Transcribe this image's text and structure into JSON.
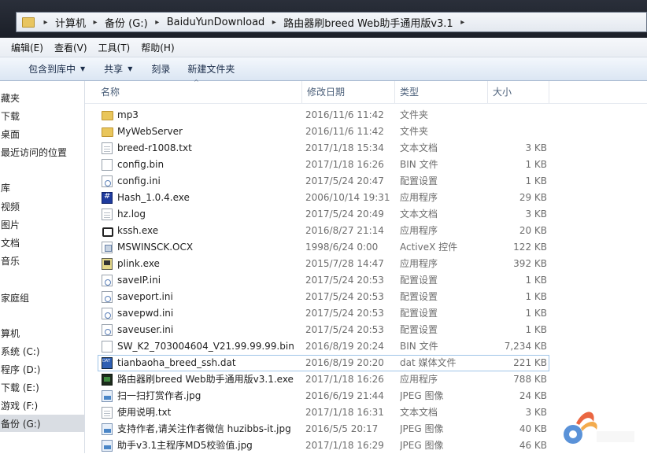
{
  "address": {
    "crumbs": [
      "计算机",
      "备份 (G:)",
      "BaiduYunDownload",
      "路由器刷breed Web助手通用版v3.1"
    ]
  },
  "menu": [
    "编辑(E)",
    "查看(V)",
    "工具(T)",
    "帮助(H)"
  ],
  "toolbar": {
    "include_library": "包含到库中",
    "share": "共享",
    "burn": "刻录",
    "new_folder": "新建文件夹"
  },
  "nav": {
    "items": [
      {
        "label": "藏夹",
        "selected": false
      },
      {
        "label": "下载",
        "selected": false
      },
      {
        "label": "桌面",
        "selected": false
      },
      {
        "label": "最近访问的位置",
        "selected": false
      },
      {
        "label": "",
        "selected": false
      },
      {
        "label": "库",
        "selected": false
      },
      {
        "label": "视频",
        "selected": false
      },
      {
        "label": "图片",
        "selected": false
      },
      {
        "label": "文档",
        "selected": false
      },
      {
        "label": "音乐",
        "selected": false
      },
      {
        "label": "",
        "selected": false
      },
      {
        "label": "家庭组",
        "selected": false
      },
      {
        "label": "",
        "selected": false
      },
      {
        "label": "算机",
        "selected": false
      },
      {
        "label": "系统 (C:)",
        "selected": false
      },
      {
        "label": "程序 (D:)",
        "selected": false
      },
      {
        "label": "下载 (E:)",
        "selected": false
      },
      {
        "label": "游戏 (F:)",
        "selected": false
      },
      {
        "label": "备份 (G:)",
        "selected": true
      }
    ]
  },
  "columns": {
    "name": "名称",
    "date": "修改日期",
    "type": "类型",
    "size": "大小"
  },
  "files": [
    {
      "name": "mp3",
      "date": "2016/11/6 11:42",
      "type": "文件夹",
      "size": "",
      "icon": "folder-icon"
    },
    {
      "name": "MyWebServer",
      "date": "2016/11/6 11:42",
      "type": "文件夹",
      "size": "",
      "icon": "folder-icon"
    },
    {
      "name": "breed-r1008.txt",
      "date": "2017/1/18 15:34",
      "type": "文本文档",
      "size": "3 KB",
      "icon": "text-file-icon"
    },
    {
      "name": "config.bin",
      "date": "2017/1/18 16:26",
      "type": "BIN 文件",
      "size": "1 KB",
      "icon": "blank-file-icon"
    },
    {
      "name": "config.ini",
      "date": "2017/5/24 20:47",
      "type": "配置设置",
      "size": "1 KB",
      "icon": "ini-file-icon"
    },
    {
      "name": "Hash_1.0.4.exe",
      "date": "2006/10/14 19:31",
      "type": "应用程序",
      "size": "29 KB",
      "icon": "hash-app-icon"
    },
    {
      "name": "hz.log",
      "date": "2017/5/24 20:49",
      "type": "文本文档",
      "size": "3 KB",
      "icon": "text-file-icon"
    },
    {
      "name": "kssh.exe",
      "date": "2016/8/27 21:14",
      "type": "应用程序",
      "size": "20 KB",
      "icon": "kssh-app-icon"
    },
    {
      "name": "MSWINSCK.OCX",
      "date": "1998/6/24 0:00",
      "type": "ActiveX 控件",
      "size": "122 KB",
      "icon": "activex-icon"
    },
    {
      "name": "plink.exe",
      "date": "2015/7/28 14:47",
      "type": "应用程序",
      "size": "392 KB",
      "icon": "plink-app-icon"
    },
    {
      "name": "saveIP.ini",
      "date": "2017/5/24 20:53",
      "type": "配置设置",
      "size": "1 KB",
      "icon": "ini-file-icon"
    },
    {
      "name": "saveport.ini",
      "date": "2017/5/24 20:53",
      "type": "配置设置",
      "size": "1 KB",
      "icon": "ini-file-icon"
    },
    {
      "name": "savepwd.ini",
      "date": "2017/5/24 20:53",
      "type": "配置设置",
      "size": "1 KB",
      "icon": "ini-file-icon"
    },
    {
      "name": "saveuser.ini",
      "date": "2017/5/24 20:53",
      "type": "配置设置",
      "size": "1 KB",
      "icon": "ini-file-icon"
    },
    {
      "name": "SW_K2_703004604_V21.99.99.99.bin",
      "date": "2016/8/19 20:24",
      "type": "BIN 文件",
      "size": "7,234 KB",
      "icon": "blank-file-icon"
    },
    {
      "name": "tianbaoha_breed_ssh.dat",
      "date": "2016/8/19 20:20",
      "type": "dat 媒体文件",
      "size": "221 KB",
      "icon": "dat-file-icon",
      "hover": true
    },
    {
      "name": "路由器刷breed Web助手通用版v3.1.exe",
      "date": "2017/1/18 16:26",
      "type": "应用程序",
      "size": "788 KB",
      "icon": "exe-app-icon"
    },
    {
      "name": "扫一扫打赏作者.jpg",
      "date": "2016/6/19 21:44",
      "type": "JPEG 图像",
      "size": "24 KB",
      "icon": "image-file-icon"
    },
    {
      "name": "使用说明.txt",
      "date": "2017/1/18 16:31",
      "type": "文本文档",
      "size": "3 KB",
      "icon": "text-file-icon"
    },
    {
      "name": "支持作者,请关注作者微信 huzibbs-it.jpg",
      "date": "2016/5/5 20:17",
      "type": "JPEG 图像",
      "size": "40 KB",
      "icon": "image-file-icon"
    },
    {
      "name": "助手v3.1主程序MD5校验值.jpg",
      "date": "2017/1/18 16:29",
      "type": "JPEG 图像",
      "size": "46 KB",
      "icon": "image-file-icon"
    }
  ]
}
